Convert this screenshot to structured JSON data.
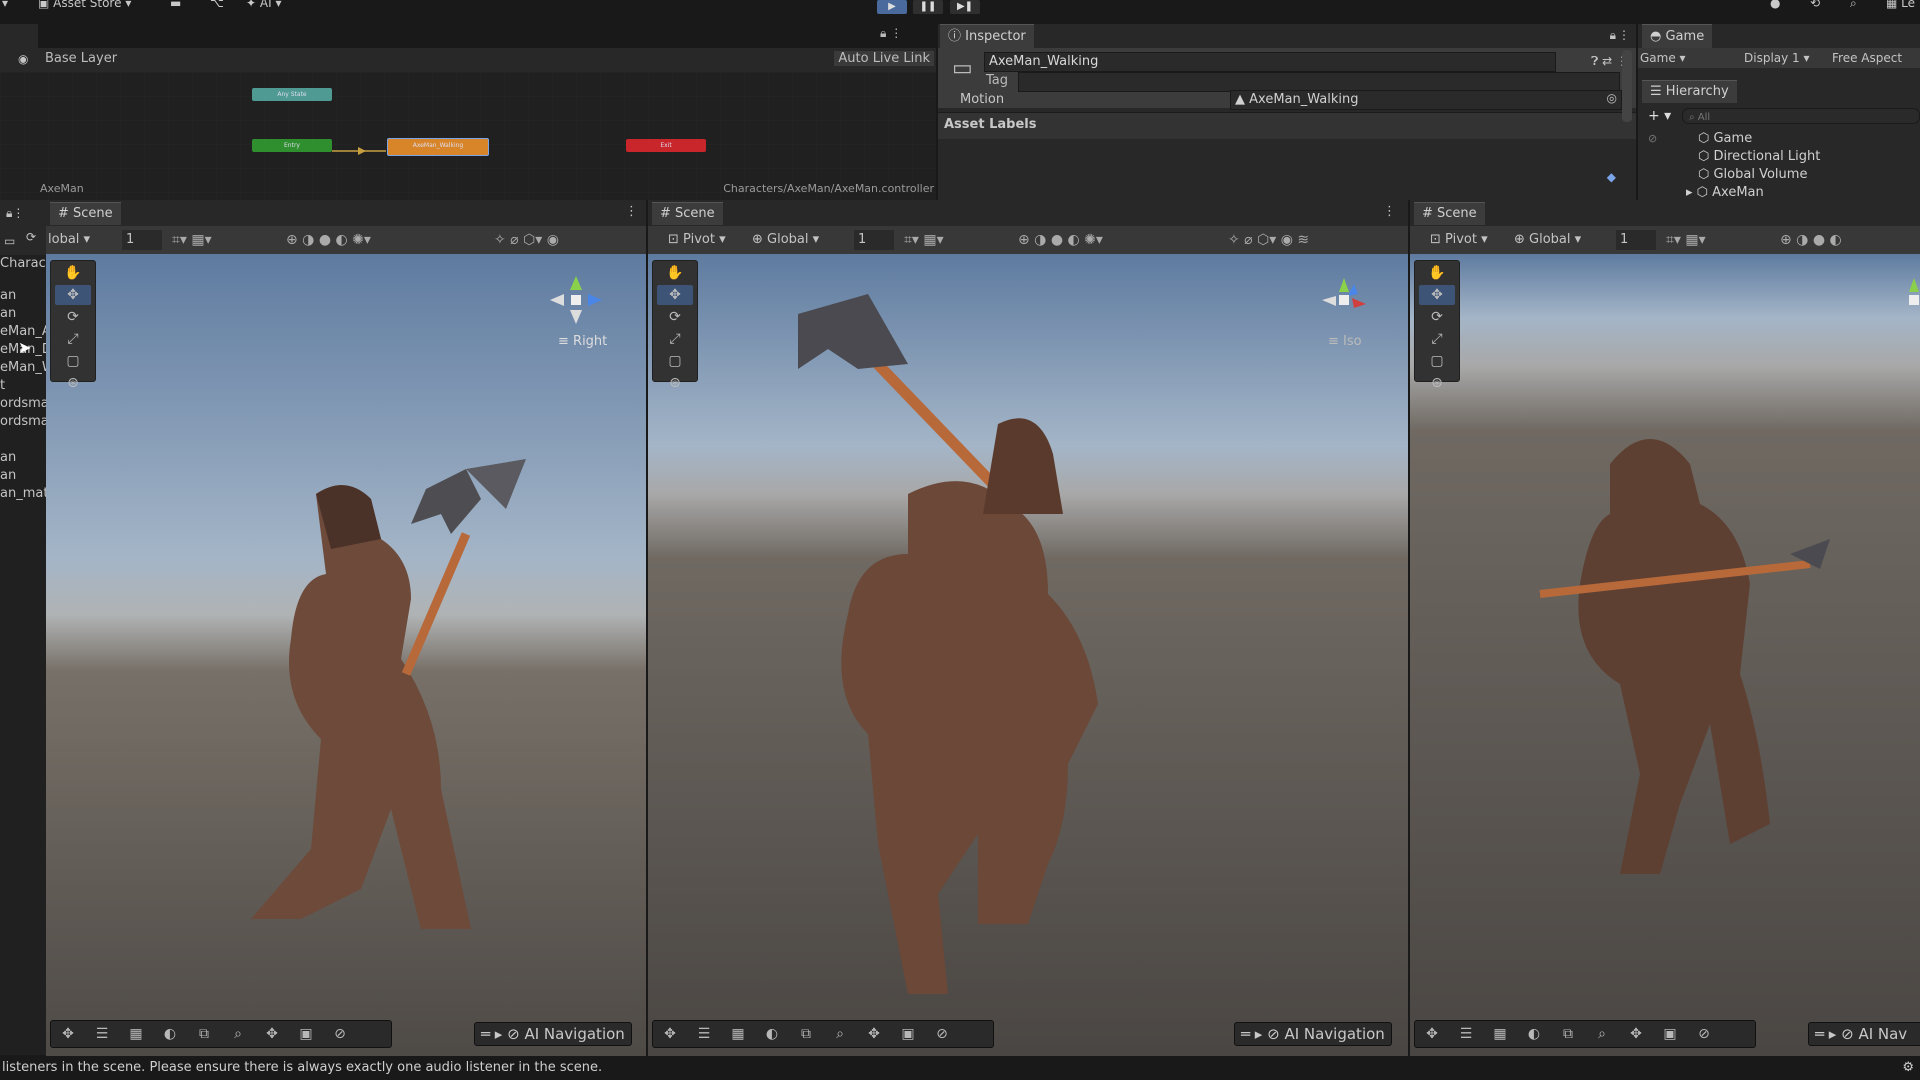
{
  "toolbar": {
    "asset_store": "Asset Store",
    "ai": "AI",
    "account_label": "Le"
  },
  "animator": {
    "layer": "Base Layer",
    "auto_live_link": "Auto Live Link",
    "states": {
      "any": "Any State",
      "entry": "Entry",
      "walking": "AxeMan_Walking",
      "exit": "Exit"
    },
    "footer_left": "AxeMan",
    "footer_right": "Characters/AxeMan/AxeMan.controller"
  },
  "inspector": {
    "tab": "Inspector",
    "name": "AxeMan_Walking",
    "tag_label": "Tag",
    "motion_label": "Motion",
    "motion_value": "AxeMan_Walking",
    "asset_labels": "Asset Labels"
  },
  "game": {
    "tab": "Game",
    "dropdown": "Game",
    "display": "Display 1",
    "aspect": "Free Aspect"
  },
  "hierarchy": {
    "tab": "Hierarchy",
    "search_placeholder": "All",
    "items": [
      "Game",
      "Directional Light",
      "Global Volume",
      "AxeMan"
    ]
  },
  "scenes": [
    {
      "tab": "Scene",
      "pivot": "",
      "global": "lobal",
      "num": "1",
      "gizmo": "Right",
      "ai_nav": "AI Navigation"
    },
    {
      "tab": "Scene",
      "pivot": "Pivot",
      "global": "Global",
      "num": "1",
      "gizmo": "Iso",
      "ai_nav": "AI Navigation"
    },
    {
      "tab": "Scene",
      "pivot": "Pivot",
      "global": "Global",
      "num": "1",
      "gizmo": "",
      "ai_nav": "AI Nav"
    }
  ],
  "project": {
    "header": "Characte",
    "items": [
      "an",
      "an",
      "eMan_A",
      "eMan_D",
      "eMan_W",
      "t",
      "ordsma",
      "ordsma",
      "",
      "an",
      "an",
      "an_mat"
    ]
  },
  "status": "listeners in the scene. Please ensure there is always exactly one audio listener in the scene.",
  "colors": {
    "accent": "#3e5476",
    "state_any": "#4f9b93",
    "state_entry": "#2f8f2f",
    "state_walking": "#d8852a",
    "state_exit": "#c8262a"
  }
}
